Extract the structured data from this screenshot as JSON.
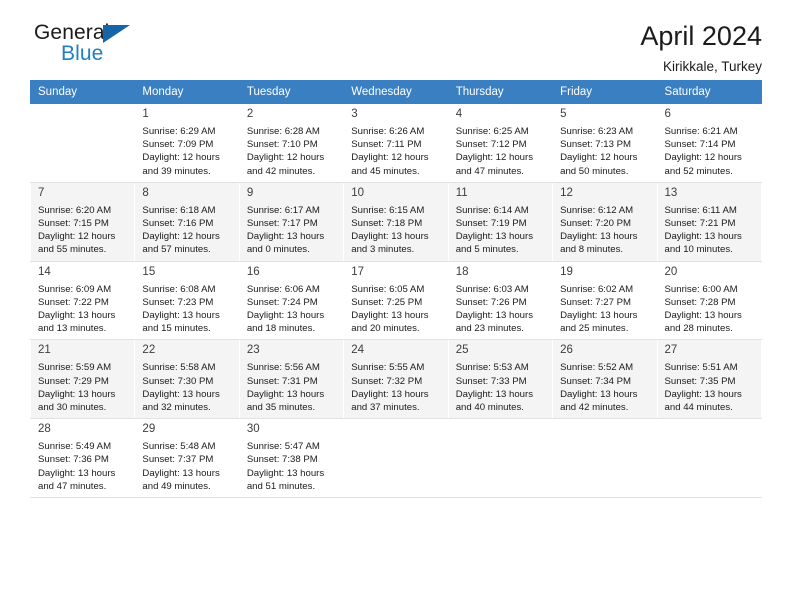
{
  "brand": {
    "name_top": "General",
    "name_bottom": "Blue",
    "triangle_color": "#1565a8",
    "blue_text_color": "#1f7ec4"
  },
  "header": {
    "title": "April 2024",
    "subtitle": "Kirikkale, Turkey"
  },
  "theme": {
    "header_row_bg": "#3a7fc1",
    "header_row_text": "#ffffff",
    "shaded_row_bg": "#f4f4f4",
    "cell_border": "#e2e2e2"
  },
  "weekday_headers": [
    "Sunday",
    "Monday",
    "Tuesday",
    "Wednesday",
    "Thursday",
    "Friday",
    "Saturday"
  ],
  "labels": {
    "sunrise_prefix": "Sunrise:",
    "sunset_prefix": "Sunset:",
    "daylight_prefix": "Daylight:"
  },
  "weeks": [
    {
      "shaded": false,
      "days": [
        {
          "empty": true
        },
        {
          "day": "1",
          "sunrise": "Sunrise: 6:29 AM",
          "sunset": "Sunset: 7:09 PM",
          "daylight_line1": "Daylight: 12 hours",
          "daylight_line2": "and 39 minutes."
        },
        {
          "day": "2",
          "sunrise": "Sunrise: 6:28 AM",
          "sunset": "Sunset: 7:10 PM",
          "daylight_line1": "Daylight: 12 hours",
          "daylight_line2": "and 42 minutes."
        },
        {
          "day": "3",
          "sunrise": "Sunrise: 6:26 AM",
          "sunset": "Sunset: 7:11 PM",
          "daylight_line1": "Daylight: 12 hours",
          "daylight_line2": "and 45 minutes."
        },
        {
          "day": "4",
          "sunrise": "Sunrise: 6:25 AM",
          "sunset": "Sunset: 7:12 PM",
          "daylight_line1": "Daylight: 12 hours",
          "daylight_line2": "and 47 minutes."
        },
        {
          "day": "5",
          "sunrise": "Sunrise: 6:23 AM",
          "sunset": "Sunset: 7:13 PM",
          "daylight_line1": "Daylight: 12 hours",
          "daylight_line2": "and 50 minutes."
        },
        {
          "day": "6",
          "sunrise": "Sunrise: 6:21 AM",
          "sunset": "Sunset: 7:14 PM",
          "daylight_line1": "Daylight: 12 hours",
          "daylight_line2": "and 52 minutes."
        }
      ]
    },
    {
      "shaded": true,
      "days": [
        {
          "day": "7",
          "sunrise": "Sunrise: 6:20 AM",
          "sunset": "Sunset: 7:15 PM",
          "daylight_line1": "Daylight: 12 hours",
          "daylight_line2": "and 55 minutes."
        },
        {
          "day": "8",
          "sunrise": "Sunrise: 6:18 AM",
          "sunset": "Sunset: 7:16 PM",
          "daylight_line1": "Daylight: 12 hours",
          "daylight_line2": "and 57 minutes."
        },
        {
          "day": "9",
          "sunrise": "Sunrise: 6:17 AM",
          "sunset": "Sunset: 7:17 PM",
          "daylight_line1": "Daylight: 13 hours",
          "daylight_line2": "and 0 minutes."
        },
        {
          "day": "10",
          "sunrise": "Sunrise: 6:15 AM",
          "sunset": "Sunset: 7:18 PM",
          "daylight_line1": "Daylight: 13 hours",
          "daylight_line2": "and 3 minutes."
        },
        {
          "day": "11",
          "sunrise": "Sunrise: 6:14 AM",
          "sunset": "Sunset: 7:19 PM",
          "daylight_line1": "Daylight: 13 hours",
          "daylight_line2": "and 5 minutes."
        },
        {
          "day": "12",
          "sunrise": "Sunrise: 6:12 AM",
          "sunset": "Sunset: 7:20 PM",
          "daylight_line1": "Daylight: 13 hours",
          "daylight_line2": "and 8 minutes."
        },
        {
          "day": "13",
          "sunrise": "Sunrise: 6:11 AM",
          "sunset": "Sunset: 7:21 PM",
          "daylight_line1": "Daylight: 13 hours",
          "daylight_line2": "and 10 minutes."
        }
      ]
    },
    {
      "shaded": false,
      "days": [
        {
          "day": "14",
          "sunrise": "Sunrise: 6:09 AM",
          "sunset": "Sunset: 7:22 PM",
          "daylight_line1": "Daylight: 13 hours",
          "daylight_line2": "and 13 minutes."
        },
        {
          "day": "15",
          "sunrise": "Sunrise: 6:08 AM",
          "sunset": "Sunset: 7:23 PM",
          "daylight_line1": "Daylight: 13 hours",
          "daylight_line2": "and 15 minutes."
        },
        {
          "day": "16",
          "sunrise": "Sunrise: 6:06 AM",
          "sunset": "Sunset: 7:24 PM",
          "daylight_line1": "Daylight: 13 hours",
          "daylight_line2": "and 18 minutes."
        },
        {
          "day": "17",
          "sunrise": "Sunrise: 6:05 AM",
          "sunset": "Sunset: 7:25 PM",
          "daylight_line1": "Daylight: 13 hours",
          "daylight_line2": "and 20 minutes."
        },
        {
          "day": "18",
          "sunrise": "Sunrise: 6:03 AM",
          "sunset": "Sunset: 7:26 PM",
          "daylight_line1": "Daylight: 13 hours",
          "daylight_line2": "and 23 minutes."
        },
        {
          "day": "19",
          "sunrise": "Sunrise: 6:02 AM",
          "sunset": "Sunset: 7:27 PM",
          "daylight_line1": "Daylight: 13 hours",
          "daylight_line2": "and 25 minutes."
        },
        {
          "day": "20",
          "sunrise": "Sunrise: 6:00 AM",
          "sunset": "Sunset: 7:28 PM",
          "daylight_line1": "Daylight: 13 hours",
          "daylight_line2": "and 28 minutes."
        }
      ]
    },
    {
      "shaded": true,
      "days": [
        {
          "day": "21",
          "sunrise": "Sunrise: 5:59 AM",
          "sunset": "Sunset: 7:29 PM",
          "daylight_line1": "Daylight: 13 hours",
          "daylight_line2": "and 30 minutes."
        },
        {
          "day": "22",
          "sunrise": "Sunrise: 5:58 AM",
          "sunset": "Sunset: 7:30 PM",
          "daylight_line1": "Daylight: 13 hours",
          "daylight_line2": "and 32 minutes."
        },
        {
          "day": "23",
          "sunrise": "Sunrise: 5:56 AM",
          "sunset": "Sunset: 7:31 PM",
          "daylight_line1": "Daylight: 13 hours",
          "daylight_line2": "and 35 minutes."
        },
        {
          "day": "24",
          "sunrise": "Sunrise: 5:55 AM",
          "sunset": "Sunset: 7:32 PM",
          "daylight_line1": "Daylight: 13 hours",
          "daylight_line2": "and 37 minutes."
        },
        {
          "day": "25",
          "sunrise": "Sunrise: 5:53 AM",
          "sunset": "Sunset: 7:33 PM",
          "daylight_line1": "Daylight: 13 hours",
          "daylight_line2": "and 40 minutes."
        },
        {
          "day": "26",
          "sunrise": "Sunrise: 5:52 AM",
          "sunset": "Sunset: 7:34 PM",
          "daylight_line1": "Daylight: 13 hours",
          "daylight_line2": "and 42 minutes."
        },
        {
          "day": "27",
          "sunrise": "Sunrise: 5:51 AM",
          "sunset": "Sunset: 7:35 PM",
          "daylight_line1": "Daylight: 13 hours",
          "daylight_line2": "and 44 minutes."
        }
      ]
    },
    {
      "shaded": false,
      "days": [
        {
          "day": "28",
          "sunrise": "Sunrise: 5:49 AM",
          "sunset": "Sunset: 7:36 PM",
          "daylight_line1": "Daylight: 13 hours",
          "daylight_line2": "and 47 minutes."
        },
        {
          "day": "29",
          "sunrise": "Sunrise: 5:48 AM",
          "sunset": "Sunset: 7:37 PM",
          "daylight_line1": "Daylight: 13 hours",
          "daylight_line2": "and 49 minutes."
        },
        {
          "day": "30",
          "sunrise": "Sunrise: 5:47 AM",
          "sunset": "Sunset: 7:38 PM",
          "daylight_line1": "Daylight: 13 hours",
          "daylight_line2": "and 51 minutes."
        },
        {
          "empty": true
        },
        {
          "empty": true
        },
        {
          "empty": true
        },
        {
          "empty": true
        }
      ]
    }
  ]
}
